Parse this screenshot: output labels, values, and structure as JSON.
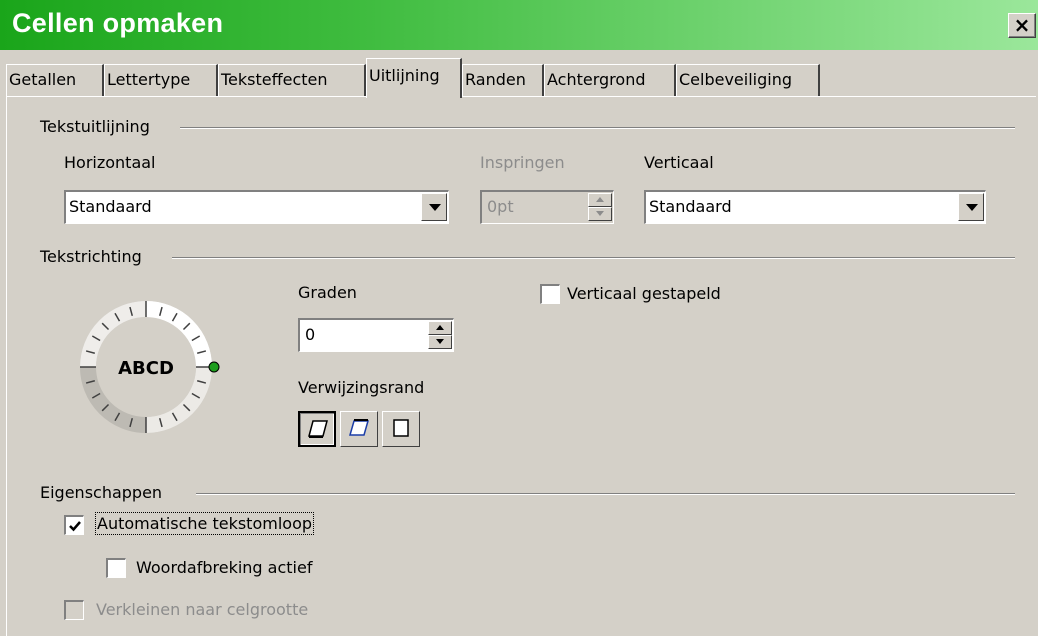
{
  "window": {
    "title": "Cellen opmaken",
    "close_label": "×"
  },
  "tabs": [
    {
      "label": "Getallen"
    },
    {
      "label": "Lettertype"
    },
    {
      "label": "Teksteffecten"
    },
    {
      "label": "Uitlijning"
    },
    {
      "label": "Randen"
    },
    {
      "label": "Achtergrond"
    },
    {
      "label": "Celbeveiliging"
    }
  ],
  "active_tab": "Uitlijning",
  "text_alignment": {
    "group_title": "Tekstuitlijning",
    "horizontal_label": "Horizontaal",
    "horizontal_value": "Standaard",
    "indent_label": "Inspringen",
    "indent_value": "0pt",
    "vertical_label": "Verticaal",
    "vertical_value": "Standaard"
  },
  "text_direction": {
    "group_title": "Tekstrichting",
    "dial_text": "ABCD",
    "degrees_label": "Graden",
    "degrees_value": "0",
    "reference_label": "Verwijzingsrand",
    "stacked_label": "Verticaal gestapeld",
    "stacked_checked": false
  },
  "properties": {
    "group_title": "Eigenschappen",
    "auto_wrap_label": "Automatische tekstomloop",
    "auto_wrap_checked": true,
    "hyphenation_label": "Woordafbreking actief",
    "hyphenation_checked": false,
    "shrink_label": "Verkleinen naar celgrootte",
    "shrink_checked": false
  },
  "colors": {
    "title_gradient_start": "#1aa51a",
    "dialog_bg": "#d4d0c8",
    "dial_marker": "#1e9e1e"
  }
}
